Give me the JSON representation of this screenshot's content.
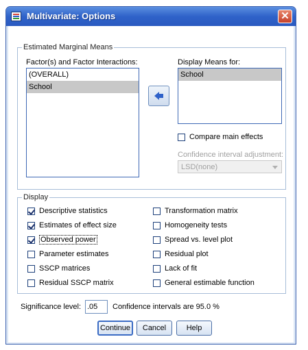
{
  "window": {
    "title": "Multivariate: Options",
    "close_symbol": "✕"
  },
  "emm": {
    "legend": "Estimated Marginal Means",
    "factors_label": "Factor(s) and Factor Interactions:",
    "factors_items": [
      "(OVERALL)",
      "School"
    ],
    "display_means_label": "Display Means for:",
    "display_means_items": [
      "School"
    ],
    "compare_main_effects": {
      "label": "Compare main effects",
      "checked": false
    },
    "ci_adjust_label": "Confidence interval adjustment:",
    "ci_adjust_value": "LSD(none)"
  },
  "display": {
    "legend": "Display",
    "left": [
      {
        "label": "Descriptive statistics",
        "checked": true
      },
      {
        "label": "Estimates of effect size",
        "checked": true
      },
      {
        "label": "Observed power",
        "checked": true
      },
      {
        "label": "Parameter estimates",
        "checked": false
      },
      {
        "label": "SSCP matrices",
        "checked": false
      },
      {
        "label": "Residual SSCP matrix",
        "checked": false
      }
    ],
    "right": [
      {
        "label": "Transformation matrix",
        "checked": false
      },
      {
        "label": "Homogeneity tests",
        "checked": false
      },
      {
        "label": "Spread vs. level plot",
        "checked": false
      },
      {
        "label": "Residual plot",
        "checked": false
      },
      {
        "label": "Lack of fit",
        "checked": false
      },
      {
        "label": "General estimable function",
        "checked": false
      }
    ]
  },
  "significance": {
    "label": "Significance level:",
    "value": ".05",
    "ci_text": "Confidence intervals are 95.0 %"
  },
  "buttons": {
    "continue": "Continue",
    "cancel": "Cancel",
    "help": "Help"
  }
}
